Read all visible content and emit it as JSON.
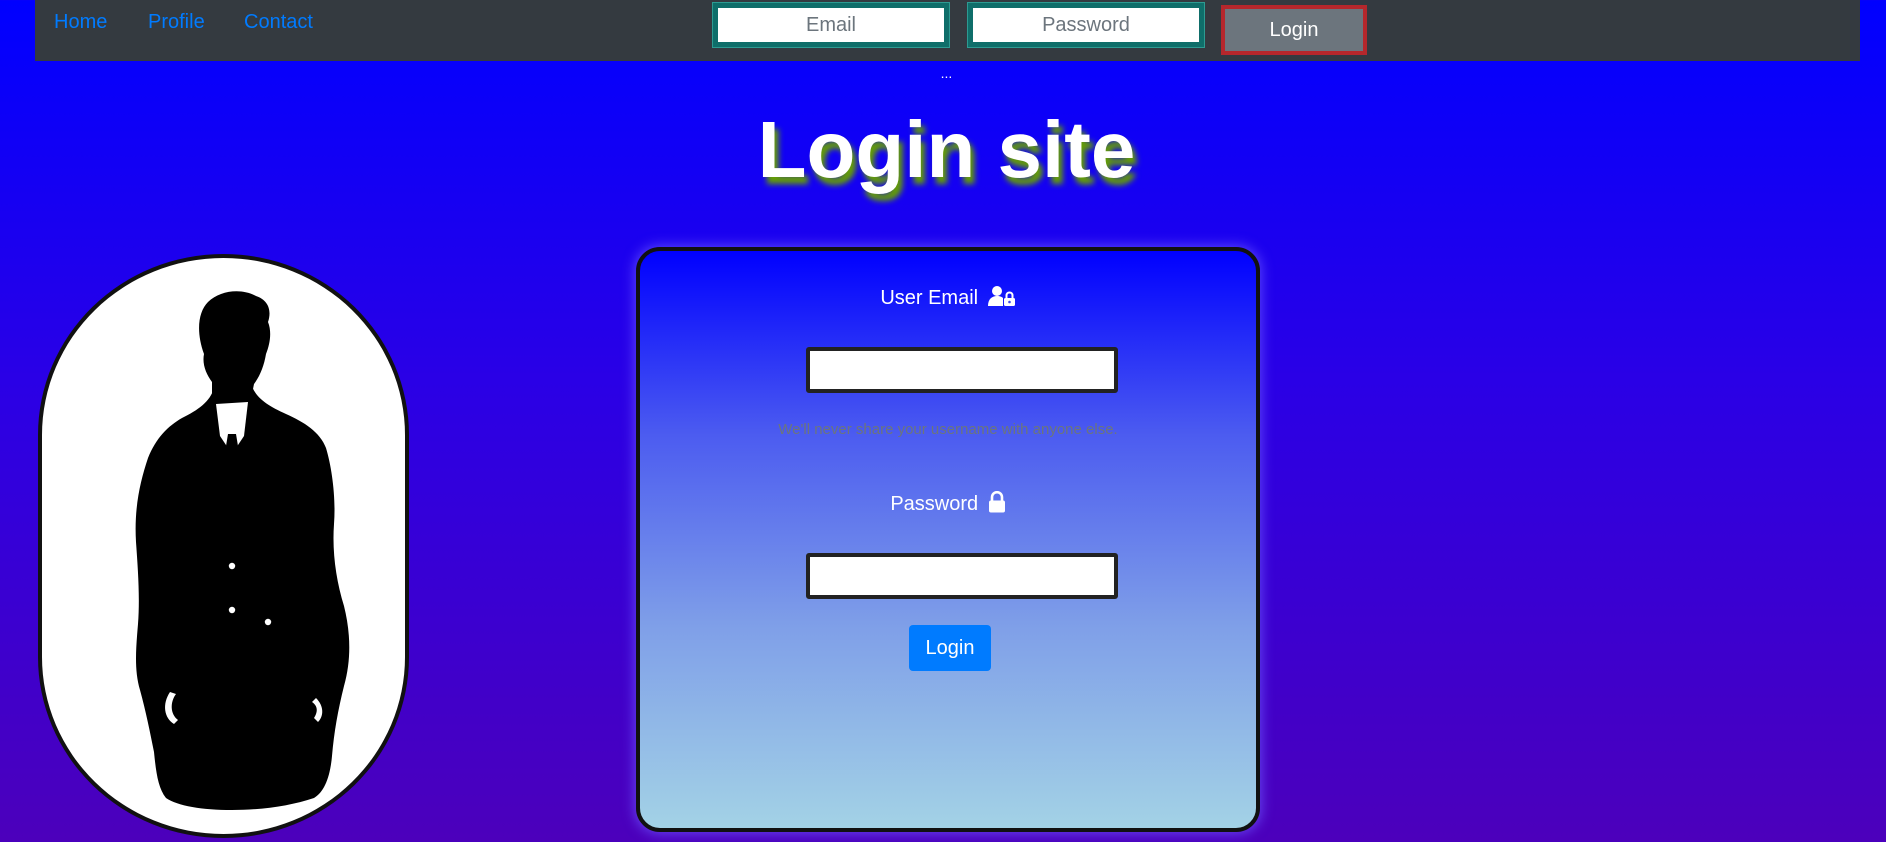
{
  "nav": {
    "links": [
      "Home",
      "Profile",
      "Contact"
    ],
    "email_placeholder": "Email",
    "password_placeholder": "Password",
    "login_label": "Login"
  },
  "ellipsis": "...",
  "page_title": "Login site",
  "form": {
    "email_label": "User Email",
    "email_icon": "user-lock-icon",
    "email_value": "",
    "help_text": "We'll never share your username with anyone else.",
    "password_label": "Password",
    "password_icon": "lock-icon",
    "password_value": "",
    "submit_label": "Login"
  },
  "avatar": {
    "icon": "businessman-silhouette-icon"
  },
  "colors": {
    "background_top": "#0000ff",
    "background_bottom": "#4c00bb",
    "navbar": "#343a40",
    "link": "#007bff",
    "primary_button": "#007bff",
    "secondary_button": "#6c757d",
    "input_border_teal": "#0f6e6a",
    "button_border_red": "#b5272c",
    "title_shadow": "#66a000",
    "card_bottom": "#a3d2e6"
  }
}
